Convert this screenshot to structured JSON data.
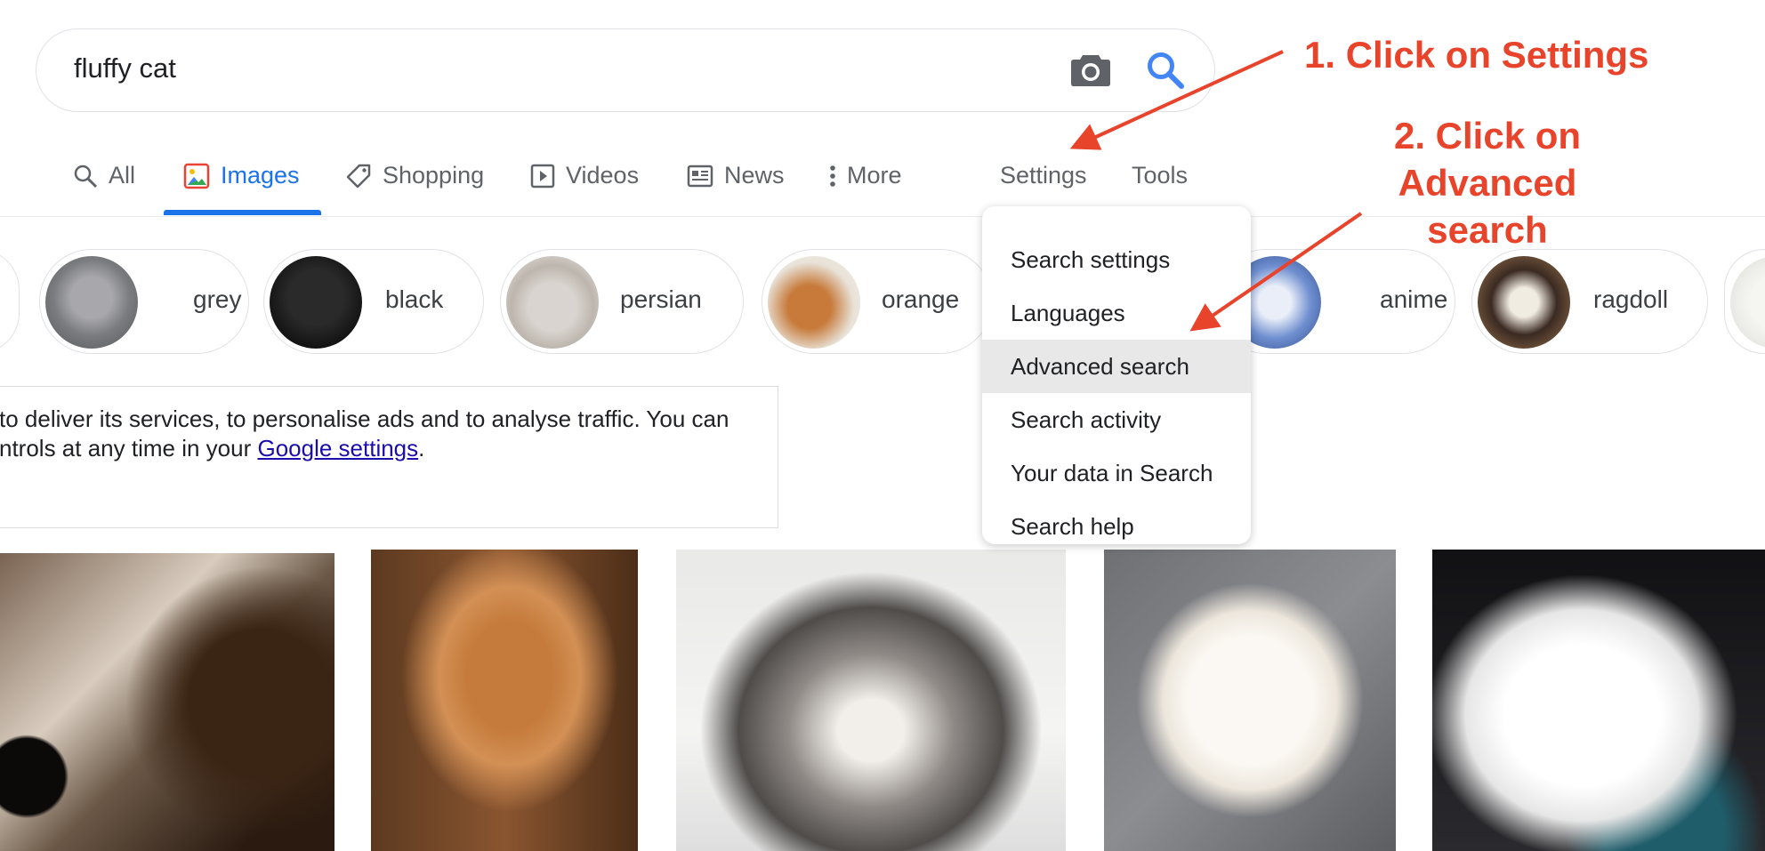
{
  "search": {
    "query": "fluffy cat"
  },
  "nav": {
    "all": "All",
    "images": "Images",
    "shopping": "Shopping",
    "videos": "Videos",
    "news": "News",
    "more": "More",
    "settings": "Settings",
    "tools": "Tools"
  },
  "chips": [
    "grey",
    "black",
    "persian",
    "orange",
    "anime",
    "ragdoll"
  ],
  "notice": {
    "line1": "to deliver its services, to personalise ads and to analyse traffic. You can",
    "line2_prefix": "ntrols at any time in your ",
    "link": "Google settings",
    "line2_suffix": "."
  },
  "settings_menu": {
    "items": [
      "Search settings",
      "Languages",
      "Advanced search",
      "Search activity",
      "Your data in Search",
      "Search help"
    ],
    "highlighted": "Advanced search"
  },
  "annotations": {
    "step1": "1. Click on Settings",
    "step2_line1": "2. Click on",
    "step2_line2": "Advanced",
    "step2_line3": "search",
    "color": "#e8442c"
  },
  "colors": {
    "accent": "#1a73e8",
    "link": "#1a0dab"
  }
}
